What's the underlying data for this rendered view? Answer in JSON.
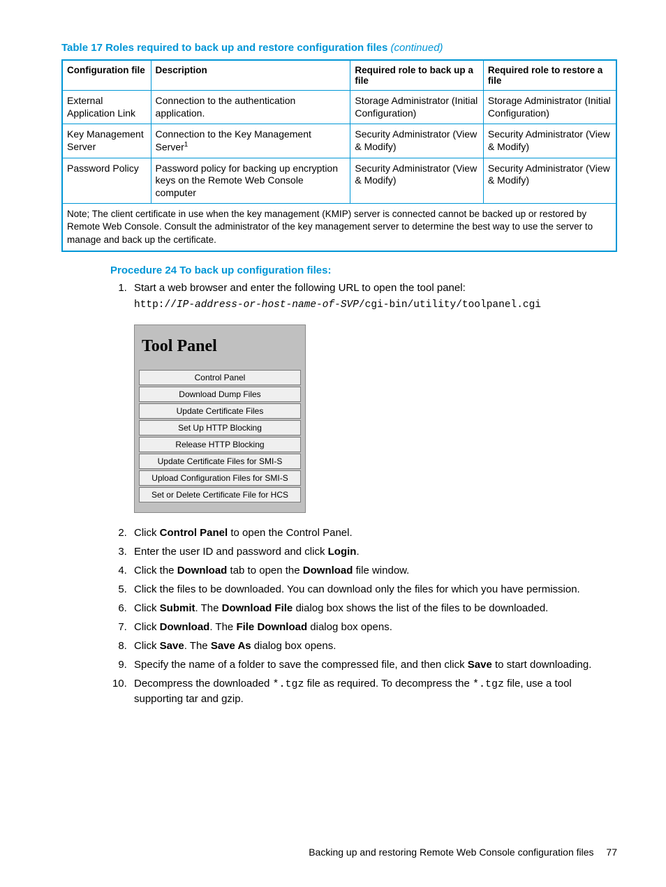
{
  "table": {
    "title_prefix": "Table 17 Roles required to back up and restore configuration files ",
    "title_suffix": "(continued)",
    "headers": {
      "c1": "Configuration file",
      "c2": "Description",
      "c3": "Required role to back up a file",
      "c4": "Required role to restore a file"
    },
    "rows": [
      {
        "c1": "External Application Link",
        "c2": "Connection to the authentication application.",
        "c3": "Storage Administrator (Initial Configuration)",
        "c4": "Storage Administrator (Initial Configuration)"
      },
      {
        "c1": "Key Management Server",
        "c2_pre": "Connection to the Key Management Server",
        "c2_sup": "1",
        "c3": "Security Administrator (View & Modify)",
        "c4": "Security Administrator (View & Modify)"
      },
      {
        "c1": "Password Policy",
        "c2": "Password policy for backing up encryption keys on the Remote Web Console computer",
        "c3": "Security Administrator (View & Modify)",
        "c4": "Security Administrator (View & Modify)"
      }
    ],
    "note": "Note; The client certificate in use when the key management (KMIP) server is connected cannot be backed up or restored by Remote Web Console. Consult the administrator of the key management server to determine the best way to use the server to manage and back up the certificate."
  },
  "procedure": {
    "title": "Procedure 24 To back up configuration files:",
    "step1": {
      "text": "Start a web browser and enter the following URL to open the tool panel:",
      "url_pre": "http://",
      "url_mid": "IP-address-or-host-name-of-SVP",
      "url_post": "/cgi-bin/utility/toolpanel.cgi"
    },
    "tool_panel": {
      "title": "Tool Panel",
      "buttons": [
        "Control Panel",
        "Download Dump Files",
        "Update Certificate Files",
        "Set Up HTTP Blocking",
        "Release HTTP Blocking",
        "Update Certificate Files for SMI-S",
        "Upload Configuration Files for SMI-S",
        "Set or Delete Certificate File for HCS"
      ]
    },
    "step2": {
      "a": "Click ",
      "b": "Control Panel",
      "c": " to open the Control Panel."
    },
    "step3": {
      "a": "Enter the user ID and password and click ",
      "b": "Login",
      "c": "."
    },
    "step4": {
      "a": "Click the ",
      "b": "Download",
      "c": " tab to open the ",
      "d": "Download",
      "e": " file window."
    },
    "step5": "Click the files to be downloaded. You can download only the files for which you have permission.",
    "step6": {
      "a": "Click ",
      "b": "Submit",
      "c": ". The ",
      "d": "Download File",
      "e": " dialog box shows the list of the files to be downloaded."
    },
    "step7": {
      "a": "Click ",
      "b": "Download",
      "c": ". The ",
      "d": "File Download",
      "e": " dialog box opens."
    },
    "step8": {
      "a": "Click ",
      "b": "Save",
      "c": ". The ",
      "d": "Save As",
      "e": " dialog box opens."
    },
    "step9": {
      "a": "Specify the name of a folder to save the compressed file, and then click ",
      "b": "Save",
      "c": " to start downloading."
    },
    "step10": {
      "a": "Decompress the downloaded ",
      "b": "*.tgz",
      "c": " file as required. To decompress the ",
      "d": "*.tgz",
      "e": " file, use a tool supporting tar and gzip."
    }
  },
  "footer": {
    "text": "Backing up and restoring Remote Web Console configuration files",
    "page": "77"
  }
}
